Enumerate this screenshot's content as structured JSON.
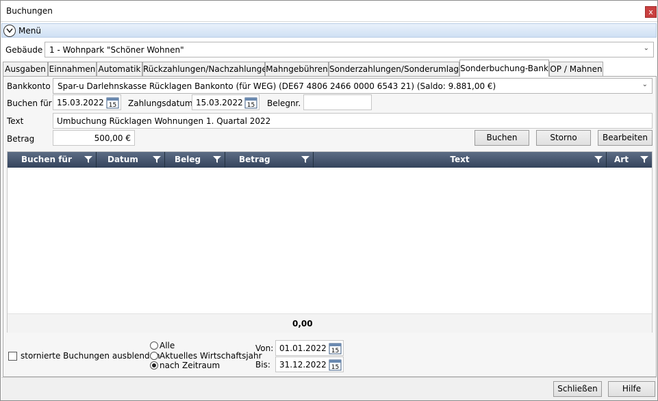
{
  "window": {
    "title": "Buchungen",
    "close": "x"
  },
  "menu": {
    "label": "Menü"
  },
  "gebaeude": {
    "label": "Gebäude",
    "value": "1 - Wohnpark \"Schöner Wohnen\""
  },
  "tabs": [
    "Ausgaben",
    "Einnahmen",
    "Automatik",
    "Rückzahlungen/Nachzahlungen",
    "Mahngebühren",
    "Sonderzahlungen/Sonderumlagen",
    "Sonderbuchung-Bank",
    "OP / Mahnen"
  ],
  "active_tab": "Sonderbuchung-Bank",
  "form": {
    "bankkonto_label": "Bankkonto",
    "bankkonto_value": "Spar-u Darlehnskasse Rücklagen Bankonto  (für WEG) (DE67 4806 2466 0000 6543 21) (Saldo: 9.881,00 €)",
    "buchen_fuer_label": "Buchen für",
    "buchen_fuer_value": "15.03.2022",
    "zahlungsdatum_label": "Zahlungsdatum",
    "zahlungsdatum_value": "15.03.2022",
    "belegnr_label": "Belegnr.",
    "belegnr_value": "",
    "text_label": "Text",
    "text_value": "Umbuchung Rücklagen Wohnungen 1. Quartal 2022",
    "betrag_label": "Betrag",
    "betrag_value": "500,00 €",
    "calendar_day": "15"
  },
  "actions": {
    "buchen": "Buchen",
    "storno": "Storno",
    "bearbeiten": "Bearbeiten"
  },
  "grid": {
    "columns": [
      "Buchen für",
      "Datum",
      "Beleg",
      "Betrag",
      "Text",
      "Art"
    ],
    "rows": [],
    "sum": "0,00"
  },
  "filter": {
    "hide_storno_label": "stornierte Buchungen ausblenden",
    "hide_storno_checked": false,
    "radio_alle": "Alle",
    "radio_wj": "Aktuelles Wirtschaftsjahr",
    "radio_zeitraum": "nach Zeitraum",
    "selected": "nach Zeitraum",
    "von_label": "Von:",
    "von_value": "01.01.2022",
    "bis_label": "Bis:",
    "bis_value": "31.12.2022"
  },
  "footer": {
    "schliessen": "Schließen",
    "hilfe": "Hilfe"
  },
  "colors": {
    "grid_header": "#3f4e66",
    "close_button": "#c94040",
    "menu_bar": "#dce8f7"
  }
}
